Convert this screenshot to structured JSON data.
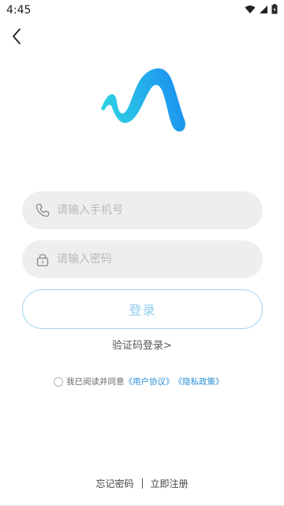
{
  "status_bar": {
    "time": "4:45",
    "icons": [
      "wifi-icon",
      "signal-icon",
      "battery-icon"
    ]
  },
  "header": {
    "back_icon": "back-chevron-icon"
  },
  "logo": {
    "icon": "app-logo-wave",
    "colors": [
      "#2fd3e3",
      "#1a8ff0"
    ]
  },
  "form": {
    "phone": {
      "icon": "phone-icon",
      "placeholder": "请输入手机号",
      "value": ""
    },
    "password": {
      "icon": "lock-icon",
      "placeholder": "请输入密码",
      "value": ""
    },
    "login_label": "登录",
    "sms_login_label": "验证码登录>"
  },
  "agreement": {
    "checked": false,
    "prefix": "我已阅读并同意",
    "user_agreement": "《用户协议》",
    "privacy_policy": "《隐私政策》"
  },
  "footer": {
    "forgot_password": "忘记密码",
    "register": "立即注册"
  },
  "colors": {
    "accent": "#1a8ff0",
    "link": "#2a8fd8",
    "button_border": "#9fd3f1",
    "button_text": "#8ecbed",
    "field_bg": "#eeeeee"
  }
}
